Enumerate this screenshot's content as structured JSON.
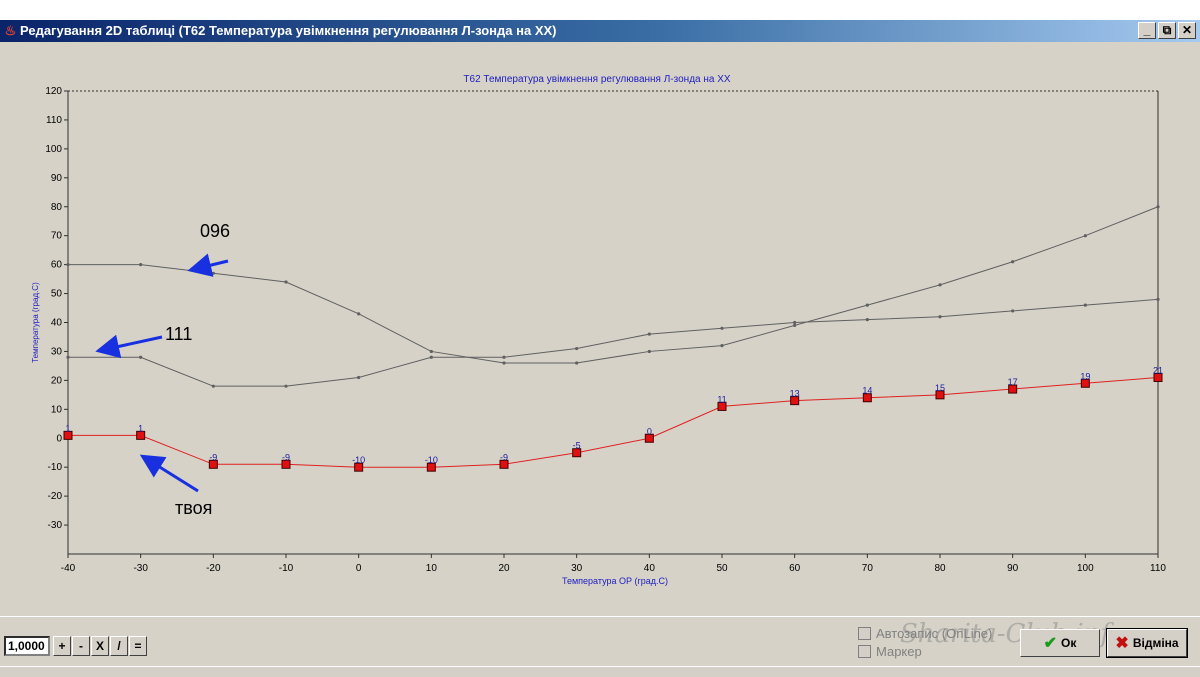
{
  "window": {
    "title": "Редагування 2D таблиці (T62 Температура увімкнення регулювання Л-зонда на ХХ)",
    "controls": {
      "minimize": "_",
      "restore": "⧉",
      "close": "✕"
    }
  },
  "chart_data": {
    "type": "line",
    "title": "T62 Температура увімкнення регулювання Л-зонда на ХХ",
    "xlabel": "Температура ОР (град.С)",
    "ylabel": "Температура (град.С)",
    "xlim": [
      -40,
      110
    ],
    "ylim": [
      -40,
      120
    ],
    "x_ticks": [
      -40,
      -30,
      -20,
      -10,
      0,
      10,
      20,
      30,
      40,
      50,
      60,
      70,
      80,
      90,
      100,
      110
    ],
    "y_ticks": [
      120,
      110,
      100,
      90,
      80,
      70,
      60,
      50,
      40,
      30,
      20,
      10,
      0,
      -10,
      -20,
      -30
    ],
    "x": [
      -40,
      -30,
      -20,
      -10,
      0,
      10,
      20,
      30,
      40,
      50,
      60,
      70,
      80,
      90,
      100,
      110
    ],
    "series": [
      {
        "name": "096",
        "color": "#606060",
        "values": [
          60,
          60,
          57,
          54,
          43,
          30,
          26,
          26,
          30,
          32,
          39,
          46,
          53,
          61,
          70,
          80
        ]
      },
      {
        "name": "111",
        "color": "#606060",
        "values": [
          28,
          28,
          18,
          18,
          21,
          28,
          28,
          31,
          36,
          38,
          40,
          41,
          42,
          44,
          46,
          48
        ]
      },
      {
        "name": "твоя",
        "color": "#e02020",
        "values": [
          1,
          1,
          -9,
          -9,
          -10,
          -10,
          -9,
          -5,
          0,
          11,
          13,
          14,
          15,
          17,
          19,
          21
        ],
        "point_labels": [
          "1",
          "1",
          "-9",
          "-9",
          "-10",
          "-10",
          "-9",
          "-5",
          "0",
          "11",
          "13",
          "14",
          "15",
          "17",
          "19",
          "21"
        ]
      }
    ],
    "annotations": [
      {
        "text": "096",
        "target_series": "096"
      },
      {
        "text": "111",
        "target_series": "111"
      },
      {
        "text": "твоя",
        "target_series": "твоя"
      }
    ],
    "grid": false
  },
  "toolbar": {
    "multiplier_value": "1,0000",
    "buttons": [
      "+",
      "-",
      "X",
      "/",
      "="
    ]
  },
  "options": {
    "autosave_label": "Автозапис (OnLine)",
    "marker_label": "Маркер"
  },
  "dialog": {
    "ok_label": "Ок",
    "cancel_label": "Відміна"
  },
  "watermark": "Sharita-Club.info"
}
